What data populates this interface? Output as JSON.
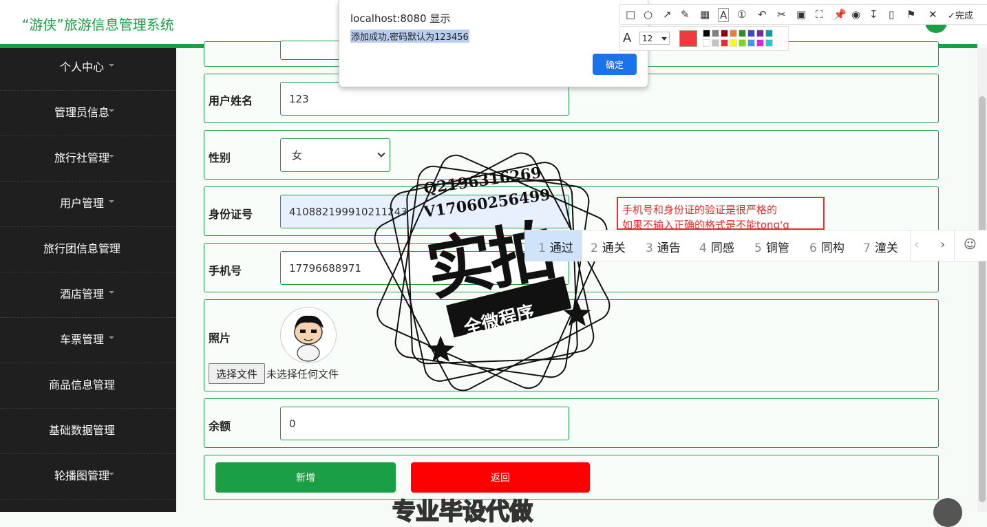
{
  "header": {
    "title": "“游侠”旅游信息管理系统"
  },
  "sidebar": {
    "items": [
      {
        "label": "个人中心"
      },
      {
        "label": "管理员信息"
      },
      {
        "label": "旅行社管理"
      },
      {
        "label": "用户管理"
      },
      {
        "label": "旅行团信息管理"
      },
      {
        "label": "酒店管理"
      },
      {
        "label": "车票管理"
      },
      {
        "label": "商品信息管理"
      },
      {
        "label": "基础数据管理"
      },
      {
        "label": "轮播图管理"
      }
    ]
  },
  "form": {
    "name_label": "用户姓名",
    "name_value": "123",
    "gender_label": "性别",
    "gender_value": "女",
    "id_label": "身份证号",
    "id_value": "410882199910211243",
    "phone_label": "手机号",
    "phone_value": "17796688971",
    "photo_label": "照片",
    "file_button": "选择文件",
    "file_status": "未选择任何文件",
    "balance_label": "余额",
    "balance_value": "0",
    "add_button": "新增",
    "back_button": "返回"
  },
  "dialog": {
    "title": "localhost:8080 显示",
    "message": "添加成功,密码默认为123456",
    "ok": "确定"
  },
  "toolbar": {
    "finish": "完成",
    "font_size": "12",
    "current_color": "#f03c3c",
    "palette": [
      "#000000",
      "#7f7f7f",
      "#880015",
      "#ed7d31",
      "#2e8b2e",
      "#3f48cc",
      "#7030a0",
      "#00a0a0",
      "#ffffff",
      "#c3c3c3",
      "#e03030",
      "#ffff00",
      "#7fd320",
      "#3d9be9",
      "#d62ad6",
      "#22cccc"
    ]
  },
  "annotation": {
    "line1": "手机号和身份证的验证是很严格的",
    "line2": "如果不输入正确的格式是不能tong'g"
  },
  "ime": {
    "candidates": [
      {
        "n": "1",
        "w": "通过"
      },
      {
        "n": "2",
        "w": "通关"
      },
      {
        "n": "3",
        "w": "通告"
      },
      {
        "n": "4",
        "w": "同感"
      },
      {
        "n": "5",
        "w": "铜管"
      },
      {
        "n": "6",
        "w": "同构"
      },
      {
        "n": "7",
        "w": "潼关"
      }
    ]
  },
  "watermark": {
    "qq": "Q2196316269",
    "vx": "V17060256499",
    "big": "实拍",
    "sub": "全微程序",
    "bottom": "专业毕设代做"
  },
  "colors": {
    "brand_green": "#1a9f45",
    "back_red": "#ff0000",
    "dialog_blue": "#1a73e8"
  }
}
